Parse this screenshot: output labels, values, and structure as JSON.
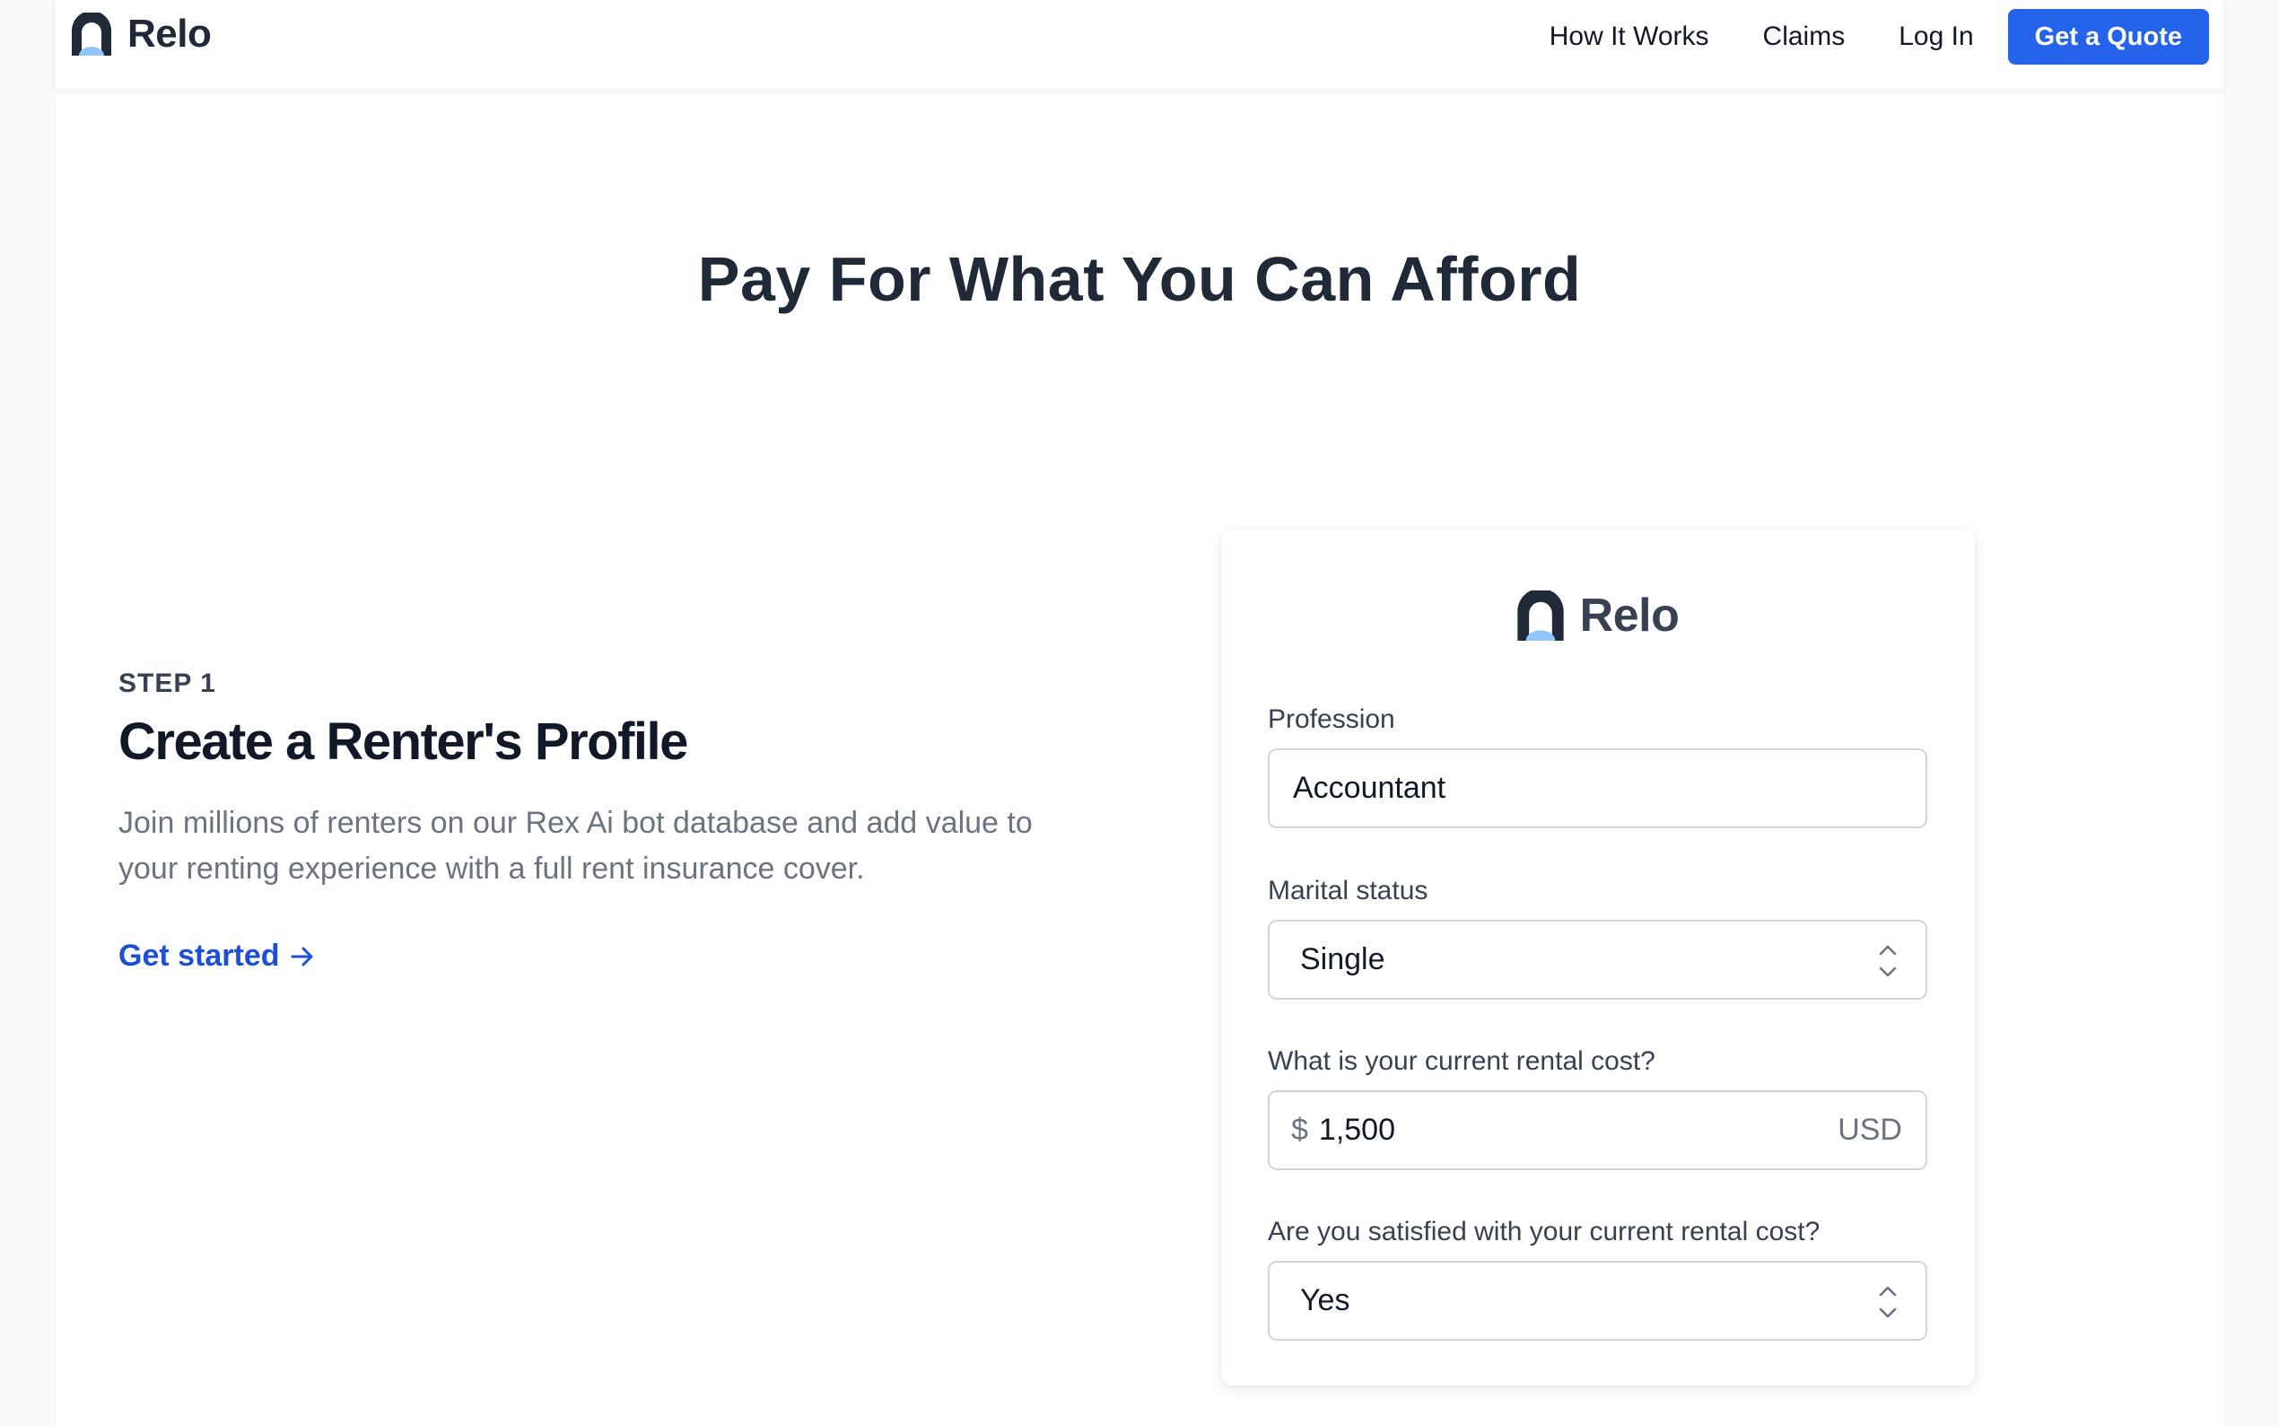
{
  "header": {
    "brand": "Relo",
    "nav": [
      "How It Works",
      "Claims",
      "Log In"
    ],
    "cta": "Get a Quote"
  },
  "hero": {
    "title": "Pay For What You Can Afford"
  },
  "step": {
    "label": "STEP 1",
    "title": "Create a Renter's Profile",
    "description": "Join millions of renters on our Rex Ai bot database and add value to your renting experience with a full rent insurance cover.",
    "link": "Get started"
  },
  "form": {
    "brand": "Relo",
    "profession": {
      "label": "Profession",
      "value": "Accountant"
    },
    "marital": {
      "label": "Marital status",
      "value": "Single"
    },
    "rental": {
      "label": "What is your current rental cost?",
      "prefix": "$",
      "value": "1,500",
      "suffix": "USD"
    },
    "satisfied": {
      "label": "Are you satisfied with your current rental cost?",
      "value": "Yes"
    }
  },
  "colors": {
    "accent": "#2563eb",
    "link": "#1d4ed8",
    "logo_dark": "#1f2937",
    "logo_light": "#93c5fd"
  },
  "icons": {
    "logo": "relo-arch-logo-icon",
    "arrow": "arrow-right-icon",
    "select": "chevron-up-down-icon"
  }
}
